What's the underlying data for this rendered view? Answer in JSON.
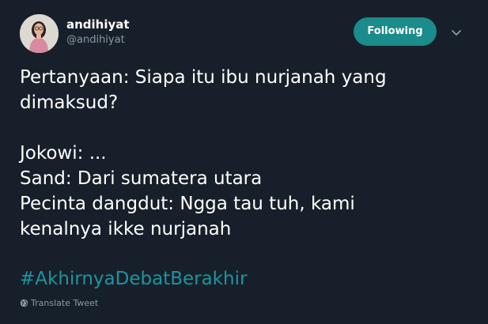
{
  "user": {
    "display_name": "andihiyat",
    "handle": "@andihiyat",
    "avatar_icon": "profile-photo"
  },
  "follow_button": {
    "label": "Following",
    "color": "#1b8b8b"
  },
  "menu": {
    "icon": "chevron-down-icon"
  },
  "tweet": {
    "text": "Pertanyaan: Siapa itu ibu nurjanah yang\ndimaksud?\n\nJokowi: ...\nSand: Dari sumatera utara\nPecinta dangdut: Ngga tau tuh, kami\nkenalnya ikke nurjanah",
    "hashtag": "#AkhirnyaDebatBerakhir",
    "hashtag_color": "#1b95a0"
  },
  "translate": {
    "label": "Translate Tweet",
    "icon": "globe-icon"
  },
  "theme": {
    "background": "#17202a",
    "text": "#ffffff",
    "muted": "#8899a6"
  }
}
